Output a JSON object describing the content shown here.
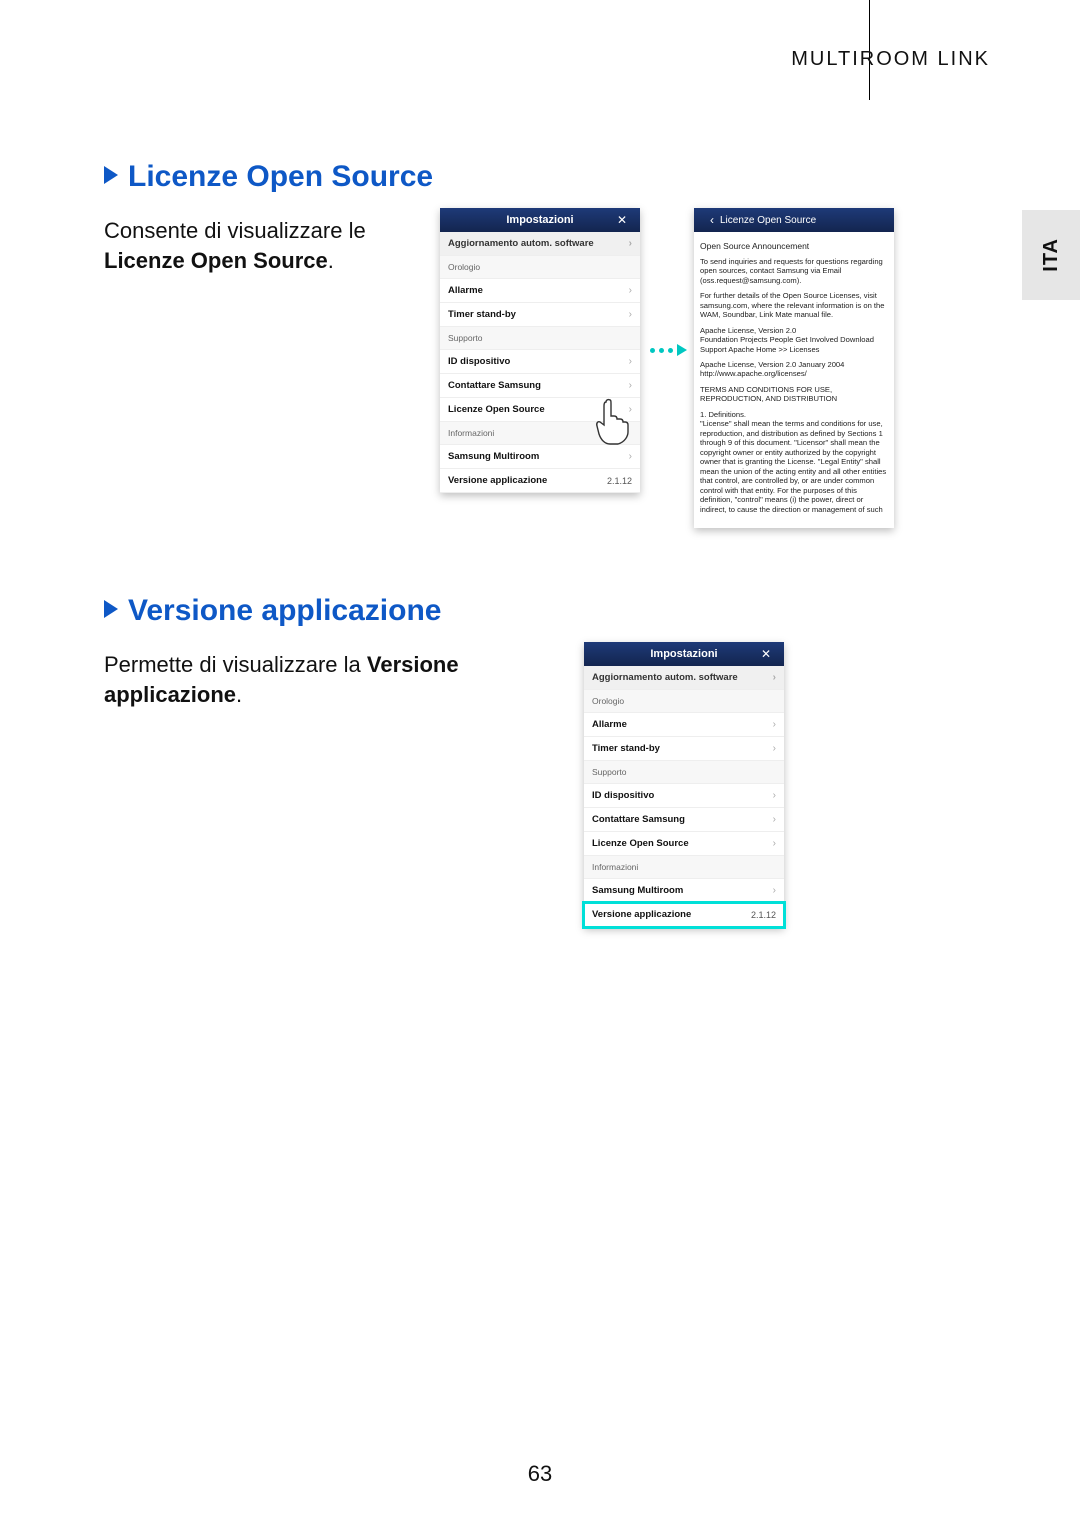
{
  "header": {
    "title": "MULTIROOM LINK"
  },
  "lang_tab": "ITA",
  "page_number": "63",
  "section1": {
    "title": "Licenze Open Source",
    "body_pre": "Consente di visualizzare le ",
    "body_bold": "Licenze Open Source",
    "body_post": "."
  },
  "section2": {
    "title": "Versione applicazione",
    "body_pre": "Permette di visualizzare la ",
    "body_bold": "Versione applicazione",
    "body_post": "."
  },
  "phone_settings": {
    "header_title": "Impostazioni",
    "items": [
      {
        "label": "Aggiornamento autom. software",
        "header": true,
        "chev": true
      },
      {
        "label": "Orologio",
        "section": true
      },
      {
        "label": "Allarme",
        "chev": true
      },
      {
        "label": "Timer stand-by",
        "chev": true
      },
      {
        "label": "Supporto",
        "section": true
      },
      {
        "label": "ID dispositivo",
        "chev": true
      },
      {
        "label": "Contattare Samsung",
        "chev": true
      },
      {
        "label": "Licenze Open Source",
        "chev": true
      },
      {
        "label": "Informazioni",
        "section": true
      },
      {
        "label": "Samsung Multiroom",
        "chev": true
      },
      {
        "label": "Versione applicazione",
        "value": "2.1.12"
      }
    ]
  },
  "phone_license": {
    "header_title": "Licenze Open Source",
    "announcement": "Open Source Announcement",
    "p1": "To send inquiries and requests for questions regarding open sources, contact Samsung via Email (oss.request@samsung.com).",
    "p2": "For further details of the Open Source Licenses, visit samsung.com, where the relevant information is on the WAM, Soundbar, Link Mate manual file.",
    "p3a": "Apache License, Version 2.0",
    "p3b": "Foundation Projects People Get Involved Download Support Apache Home >> Licenses",
    "p4a": "Apache License, Version 2.0 January 2004",
    "p4b": "http://www.apache.org/licenses/",
    "p5": "TERMS AND CONDITIONS FOR USE, REPRODUCTION, AND DISTRIBUTION",
    "p6": "1. Definitions.\n\"License\" shall mean the terms and conditions for use, reproduction, and distribution as defined by Sections 1 through 9 of this document. \"Licensor\" shall mean the copyright owner or entity authorized by the copyright owner that is granting the License. \"Legal Entity\" shall mean the union of the acting entity and all other entities that control, are controlled by, or are under common control with that entity. For the purposes of this definition, \"control\" means (i) the power, direct or indirect, to cause the direction or management of such"
  }
}
